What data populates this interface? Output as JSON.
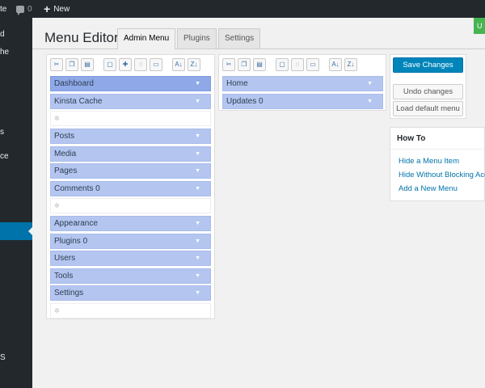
{
  "adminbar": {
    "site_fragment": "te",
    "comments_count": "0",
    "new_label": "New"
  },
  "sidebar": {
    "fragments": [
      "d",
      "he",
      "s",
      "ce",
      "S"
    ]
  },
  "header": {
    "title": "Menu Editor",
    "tabs": [
      "Admin Menu",
      "Plugins",
      "Settings"
    ],
    "corner_fragment": "U"
  },
  "left_panel": {
    "items": [
      {
        "label": "Dashboard",
        "type": "item",
        "selected": true
      },
      {
        "label": "Kinsta Cache",
        "type": "item"
      },
      {
        "label": "",
        "type": "separator"
      },
      {
        "label": "Posts",
        "type": "item"
      },
      {
        "label": "Media",
        "type": "item"
      },
      {
        "label": "Pages",
        "type": "item"
      },
      {
        "label": "Comments 0",
        "type": "item"
      },
      {
        "label": "",
        "type": "separator"
      },
      {
        "label": "Appearance",
        "type": "item"
      },
      {
        "label": "Plugins 0",
        "type": "item"
      },
      {
        "label": "Users",
        "type": "item"
      },
      {
        "label": "Tools",
        "type": "item"
      },
      {
        "label": "Settings",
        "type": "item"
      },
      {
        "label": "",
        "type": "separator"
      }
    ]
  },
  "right_panel": {
    "items": [
      {
        "label": "Home"
      },
      {
        "label": "Updates 0"
      }
    ]
  },
  "toolbar_icons": [
    "cut-icon",
    "copy-icon",
    "paste-icon",
    "new-menu-icon",
    "new-separator-icon",
    "hide-icon",
    "delete-icon",
    "sort-ascending-icon",
    "sort-descending-icon"
  ],
  "actions": {
    "save": "Save Changes",
    "undo": "Undo changes",
    "load_default": "Load default menu"
  },
  "howto": {
    "title": "How To",
    "links": [
      "Hide a Menu Item",
      "Hide Without Blocking Access",
      "Add a New Menu"
    ]
  },
  "colors": {
    "item": "#b4c6f0",
    "item_selected": "#8fa9e8",
    "primary": "#0085ba",
    "admin_dark": "#23282d"
  }
}
